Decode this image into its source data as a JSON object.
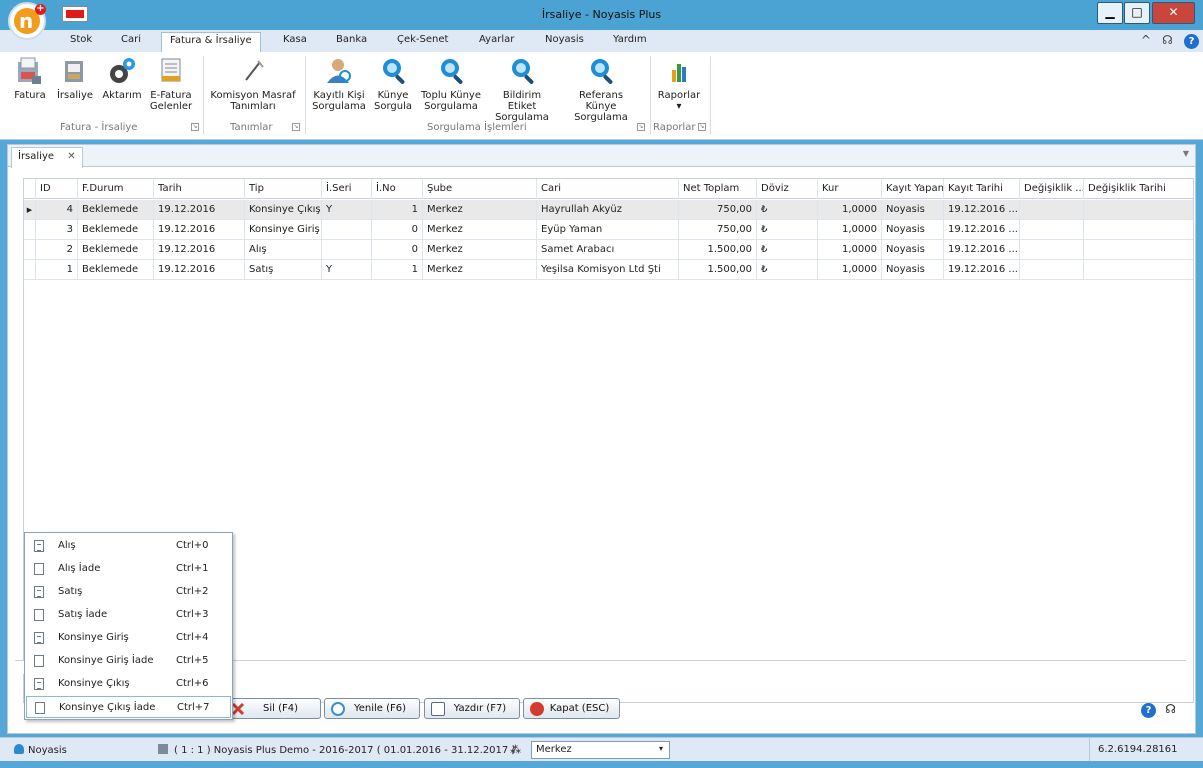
{
  "window": {
    "title": "İrsaliye - Noyasis Plus",
    "logo_letter": "n",
    "minimize": "▁",
    "maximize": "□",
    "close": "✕"
  },
  "ribbon_tabs": [
    "Stok",
    "Cari",
    "Fatura & İrsaliye",
    "Kasa",
    "Banka",
    "Çek-Senet",
    "Ayarlar",
    "Noyasis",
    "Yardım"
  ],
  "active_ribbon_tab": "Fatura & İrsaliye",
  "ribbon_tab_icons": {
    "collapse": "^",
    "headset": "☊",
    "help": "?"
  },
  "ribbon": {
    "fatura": "Fatura",
    "irsaliye": "İrsaliye",
    "aktarim": "Aktarım",
    "efatura_1": "E-Fatura",
    "efatura_2": "Gelenler",
    "komisyon_1": "Komisyon Masraf",
    "komisyon_2": "Tanımları",
    "kayitli_1": "Kayıtlı Kişi",
    "kayitli_2": "Sorgulama",
    "kunye_1": "Künye",
    "kunye_2": "Sorgula",
    "toplu_1": "Toplu Künye",
    "toplu_2": "Sorgulama",
    "bildirim_1": "Bildirim Etiket",
    "bildirim_2": "Sorgulama",
    "referans_1": "Referans Künye",
    "referans_2": "Sorgulama",
    "raporlar": "Raporlar",
    "raporlar_arrow": "▾",
    "group_fatura": "Fatura - İrsaliye",
    "group_tanimlar": "Tanımlar",
    "group_sorgulama": "Sorgulama İşlemleri",
    "group_raporlar": "Raporlar",
    "launcher": "↘"
  },
  "doc_tab": {
    "label": "İrsaliye",
    "close": "✕",
    "dropdown": "▼"
  },
  "grid": {
    "columns": [
      "ID",
      "F.Durum",
      "Tarih",
      "Tip",
      "İ.Seri",
      "İ.No",
      "Şube",
      "Cari",
      "Net Toplam",
      "Döviz",
      "Kur",
      "Kayıt Yapan",
      "Kayıt Tarihi",
      "Değişiklik ...",
      "Değişiklik Tarihi"
    ],
    "rows": [
      {
        "id": "4",
        "durum": "Beklemede",
        "tarih": "19.12.2016",
        "tip": "Konsinye Çıkış",
        "seri": "Y",
        "no": "1",
        "sube": "Merkez",
        "cari": "Hayrullah Akyüz",
        "net": "750,00",
        "doviz": "₺",
        "kur": "1,0000",
        "yapan": "Noyasis",
        "ktarih": "19.12.2016 ...",
        "degisiklik": "",
        "dtarih": ""
      },
      {
        "id": "3",
        "durum": "Beklemede",
        "tarih": "19.12.2016",
        "tip": "Konsinye Giriş",
        "seri": "",
        "no": "0",
        "sube": "Merkez",
        "cari": "Eyüp Yaman",
        "net": "750,00",
        "doviz": "₺",
        "kur": "1,0000",
        "yapan": "Noyasis",
        "ktarih": "19.12.2016 ...",
        "degisiklik": "",
        "dtarih": ""
      },
      {
        "id": "2",
        "durum": "Beklemede",
        "tarih": "19.12.2016",
        "tip": "Alış",
        "seri": "",
        "no": "0",
        "sube": "Merkez",
        "cari": "Samet Arabacı",
        "net": "1.500,00",
        "doviz": "₺",
        "kur": "1,0000",
        "yapan": "Noyasis",
        "ktarih": "19.12.2016 ...",
        "degisiklik": "",
        "dtarih": ""
      },
      {
        "id": "1",
        "durum": "Beklemede",
        "tarih": "19.12.2016",
        "tip": "Satış",
        "seri": "Y",
        "no": "1",
        "sube": "Merkez",
        "cari": "Yeşilsa Komisyon Ltd Şti",
        "net": "1.500,00",
        "doviz": "₺",
        "kur": "1,0000",
        "yapan": "Noyasis",
        "ktarih": "19.12.2016 ...",
        "degisiklik": "",
        "dtarih": ""
      }
    ],
    "selected_indicator": "▶"
  },
  "popup_menu": [
    {
      "label": "Alış",
      "shortcut": "Ctrl+0"
    },
    {
      "label": "Alış İade",
      "shortcut": "Ctrl+1"
    },
    {
      "label": "Satış",
      "shortcut": "Ctrl+2"
    },
    {
      "label": "Satış İade",
      "shortcut": "Ctrl+3"
    },
    {
      "label": "Konsinye Giriş",
      "shortcut": "Ctrl+4"
    },
    {
      "label": "Konsinye Giriş İade",
      "shortcut": "Ctrl+5"
    },
    {
      "label": "Konsinye Çıkış",
      "shortcut": "Ctrl+6"
    },
    {
      "label": "Konsinye Çıkış İade",
      "shortcut": "Ctrl+7"
    }
  ],
  "buttons": {
    "sil": "Sil (F4)",
    "yenile": "Yenile (F6)",
    "yazdir": "Yazdır (F7)",
    "kapat": "Kapat (ESC)"
  },
  "bottom_icons": {
    "help": "?",
    "headset": "☊"
  },
  "statusbar": {
    "user": "Noyasis",
    "database": "( 1 : 1 ) Noyasis Plus Demo - 2016-2017 ( 01.01.2016 - 31.12.2017 )",
    "branch": "Merkez",
    "branch_arrow": "▾",
    "version": "6.2.6194.28161"
  },
  "colors": {
    "title_bar": "#4aa3d3",
    "close_button": "#c9463d",
    "accent_orange": "#f39b1c",
    "help_blue": "#1f6fd1"
  }
}
